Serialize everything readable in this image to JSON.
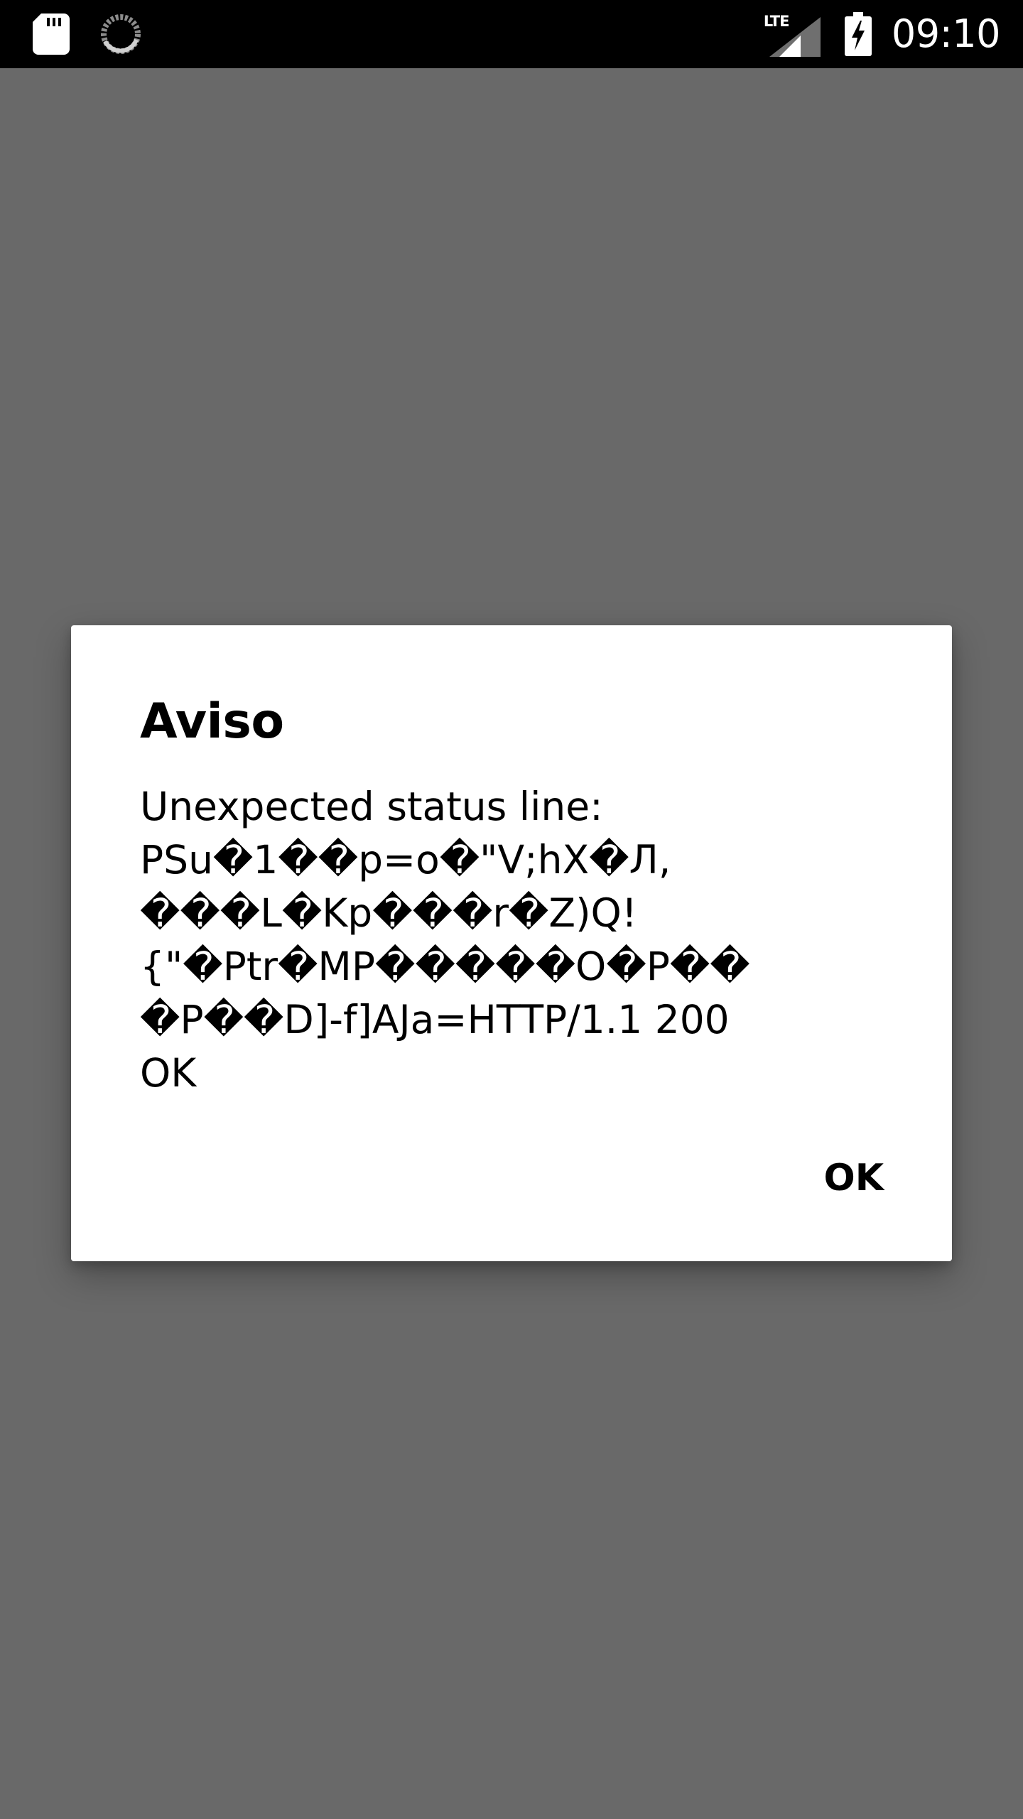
{
  "status_bar": {
    "icons": [
      "sd-card-icon",
      "sync-icon",
      "lte-signal-icon",
      "battery-charging-icon"
    ],
    "network_label": "LTE",
    "time": "09:10"
  },
  "dialog": {
    "title": "Aviso",
    "message": "Unexpected status line:\nPSu�1��p=o�\"V;hX�Л,\n���L�Kp���r�Z)Q!\n{\"�Ptr�MP�����O�P��\n�P��D]-f]AJa=HTTP/1.1 200\nOK",
    "ok_label": "OK"
  },
  "colors": {
    "scrim": "#696969",
    "status_bar": "#000000",
    "dialog_bg": "#ffffff",
    "text": "#000000"
  }
}
